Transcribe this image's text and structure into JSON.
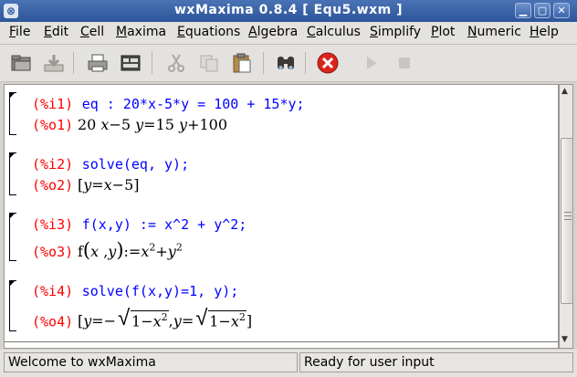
{
  "window": {
    "title": "wxMaxima 0.8.4  [ Equ5.wxm ]"
  },
  "menu": [
    {
      "accel": "F",
      "rest": "ile"
    },
    {
      "accel": "E",
      "rest": "dit"
    },
    {
      "accel": "C",
      "rest": "ell"
    },
    {
      "accel": "M",
      "rest": "axima"
    },
    {
      "accel": "E",
      "rest": "quations"
    },
    {
      "accel": "A",
      "rest": "lgebra"
    },
    {
      "accel": "C",
      "rest": "alculus"
    },
    {
      "accel": "S",
      "rest": "implify"
    },
    {
      "accel": "P",
      "rest": "lot"
    },
    {
      "accel": "N",
      "rest": "umeric"
    },
    {
      "accel": "H",
      "rest": "elp"
    }
  ],
  "toolbar": [
    "open-icon",
    "save-icon",
    "print-icon",
    "config-icon",
    "cut-icon",
    "copy-icon",
    "paste-icon",
    "find-icon",
    "interrupt-icon",
    "play-icon",
    "stop-icon"
  ],
  "cells": [
    {
      "in_label": "(%i1)",
      "input": "eq : 20*x-5*y = 100 + 15*y;",
      "out_label": "(%o1)"
    },
    {
      "in_label": "(%i2)",
      "input": "solve(eq, y);",
      "out_label": "(%o2)"
    },
    {
      "in_label": "(%i3)",
      "input": "f(x,y) := x^2 + y^2;",
      "out_label": "(%o3)"
    },
    {
      "in_label": "(%i4)",
      "input": "solve(f(x,y)=1, y);",
      "out_label": "(%o4)"
    }
  ],
  "outputs": {
    "o1": {
      "a": "20",
      "x": "x",
      "m": "−5",
      "y": "y",
      "eq": "=15",
      "y2": "y",
      "plus": "+100"
    },
    "o2": {
      "lb": "[",
      "y": "y",
      "eq": "=",
      "x": "x",
      "m": "−5",
      "rb": "]"
    },
    "o3": {
      "f": "f",
      "lp": "(",
      "x": "x",
      "comma": ",",
      "y": "y",
      "rp": ")",
      "def": ":=",
      "x2": "x",
      "e1": "2",
      "plus": "+",
      "y2": "y",
      "e2": "2"
    },
    "o4": {
      "lb": "[",
      "y": "y",
      "eqneg": "=−",
      "one": "1−",
      "x": "x",
      "e": "2",
      "comma": ",",
      "y2": "y",
      "eq2": "=",
      "one2": "1−",
      "x2": "x",
      "e2": "2",
      "rb": "]"
    }
  },
  "status": {
    "left": "Welcome to wxMaxima",
    "right": "Ready for user input"
  },
  "colors": {
    "input_label": "#ff0000",
    "input_code": "#0000ff",
    "title_bar": "#3d66aa"
  }
}
